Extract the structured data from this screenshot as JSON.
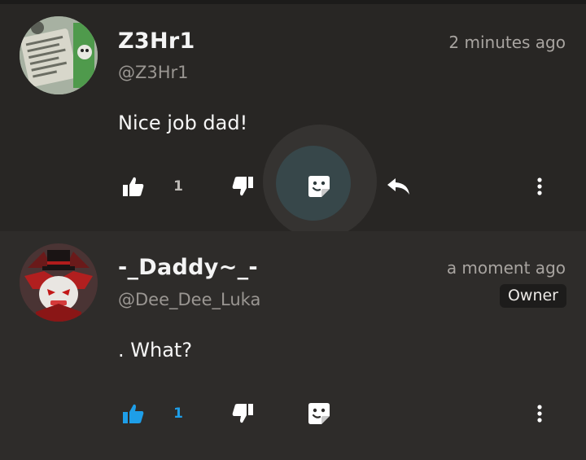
{
  "comments": [
    {
      "username": "Z3Hr1",
      "handle": "@Z3Hr1",
      "time": "2 minutes ago",
      "text": "Nice job dad!",
      "likes": "1",
      "liked": false,
      "badge": null,
      "avatar": "green-scroll-avatar"
    },
    {
      "username": "-_Daddy~_-",
      "handle": "@Dee_Dee_Luka",
      "time": "a moment ago",
      "text": ". What?",
      "likes": "1",
      "liked": true,
      "badge": "Owner",
      "avatar": "red-demon-avatar"
    }
  ],
  "colors": {
    "liked_accent": "#1e9ee8",
    "icon": "#ffffff",
    "background_top": "#282624",
    "background_bottom": "#2e2c2a"
  }
}
